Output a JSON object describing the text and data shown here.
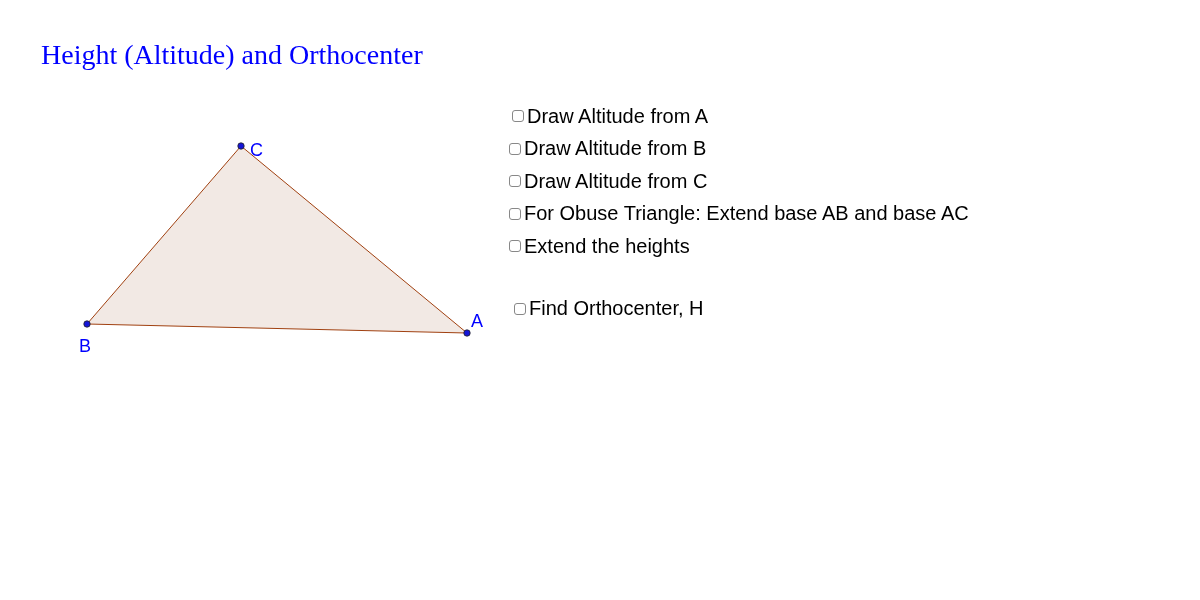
{
  "title": "Height (Altitude) and Orthocenter",
  "points": [
    {
      "label": "A"
    },
    {
      "label": "B"
    },
    {
      "label": "C"
    }
  ],
  "checkboxes": [
    {
      "label": "Draw Altitude from A",
      "checked": false
    },
    {
      "label": "Draw Altitude from B",
      "checked": false
    },
    {
      "label": "Draw Altitude from C",
      "checked": false
    },
    {
      "label": "For Obuse Triangle: Extend base AB and base AC",
      "checked": false
    },
    {
      "label": "Extend the heights",
      "checked": false
    },
    {
      "label": "Find Orthocenter, H",
      "checked": false
    }
  ]
}
